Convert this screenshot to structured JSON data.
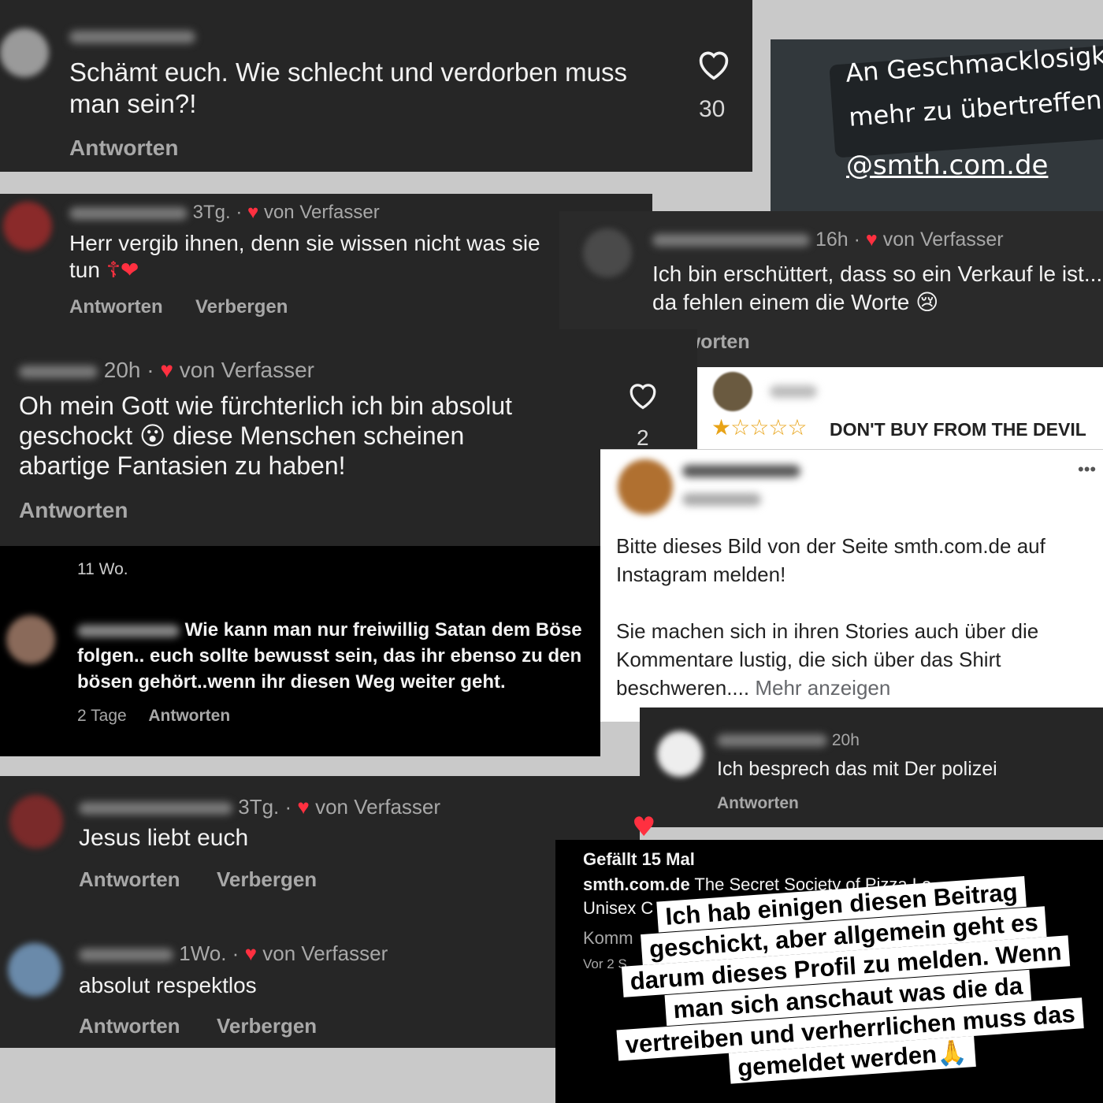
{
  "c1": {
    "text": "Schämt euch. Wie schlecht und verdorben muss man sein?!",
    "likes": "30",
    "reply": "Antworten"
  },
  "c2": {
    "time": "3Tg. ·",
    "by_author": "von Verfasser",
    "text": "Herr vergib ihnen, denn sie wissen nicht was sie tun",
    "emoji": "☦❤",
    "reply": "Antworten",
    "hide": "Verbergen"
  },
  "story1": {
    "line1": "An Geschmacklosigkeit n",
    "line2": "mehr zu übertreffen",
    "emoji": "🤮",
    "handle": "@smth.com.de"
  },
  "c3": {
    "time": "16h ·",
    "by_author": "von Verfasser",
    "text": "Ich bin erschüttert, dass so ein Verkauf le ist..... da fehlen einem die Worte",
    "emoji": "😢",
    "reply": "Antworten"
  },
  "c4": {
    "time": "20h ·",
    "by_author": "von Verfasser",
    "text1": "Oh mein Gott wie fürchterlich ich bin absolut",
    "text2a": "geschockt",
    "emoji": "😮",
    "text2b": "diese Menschen scheinen",
    "text3": "abartige Fantasien zu haben!",
    "likes": "2",
    "reply": "Antworten"
  },
  "review": {
    "stars": "★☆☆☆☆",
    "text": "DON'T BUY FROM THE DEVIL"
  },
  "fb": {
    "menu": "•••",
    "text1": "Bitte dieses Bild von der Seite smth.com.de auf Instagram melden!",
    "text2": "Sie machen sich in ihren Stories auch über die Kommentare lustig, die sich über das Shirt beschweren....",
    "more": "Mehr anzeigen"
  },
  "c5": {
    "time": "11 Wo.",
    "text": "Wie kann man nur freiwillig Satan dem Böse folgen.. euch sollte bewusst sein, das ihr ebenso zu den bösen gehört..wenn ihr diesen Weg weiter geht.",
    "days": "2 Tage",
    "reply": "Antworten"
  },
  "c6": {
    "time": "20h",
    "text": "Ich besprech das mit Der polizei",
    "reply": "Antworten"
  },
  "c7": {
    "time": "3Tg. ·",
    "by_author": "von Verfasser",
    "text": "Jesus liebt euch",
    "reply": "Antworten",
    "hide": "Verbergen"
  },
  "c8": {
    "time": "1Wo. ·",
    "by_author": "von Verfasser",
    "text": "absolut respektlos",
    "reply": "Antworten",
    "hide": "Verbergen"
  },
  "post": {
    "likes": "Gefällt 15 Mal",
    "account": "smth.com.de",
    "caption": "The Secret Society of Pizza Lo",
    "line2": "Unisex C",
    "line3": "Komm",
    "line4": "Vor 2 S"
  },
  "story2": {
    "l1": "Ich hab einigen diesen Beitrag",
    "l2": "geschickt, aber allgemein geht es",
    "l3": "darum dieses Profil zu melden. Wenn",
    "l4": "man sich anschaut was die da",
    "l5": "vertreiben und verherrlichen muss das",
    "l6": "gemeldet werden",
    "emoji": "🙏"
  }
}
